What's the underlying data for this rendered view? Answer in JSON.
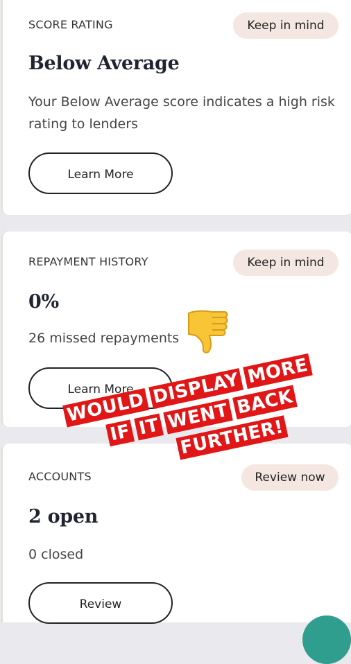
{
  "cards": [
    {
      "label": "SCORE RATING",
      "pill": "Keep in mind",
      "title": "Below Average",
      "description": "Your Below Average score indicates a high risk rating to lenders",
      "button": "Learn More"
    },
    {
      "label": "REPAYMENT HISTORY",
      "pill": "Keep in mind",
      "title": "0%",
      "description": "26 missed repayments",
      "button": "Learn More"
    },
    {
      "label": "ACCOUNTS",
      "pill": "Review now",
      "title": "2 open",
      "description": "0 closed",
      "button": "Review"
    }
  ],
  "overlay": {
    "line1": [
      "WOULD",
      "DISPLAY",
      "MORE"
    ],
    "line2": [
      "IF",
      "IT",
      "WENT",
      "BACK"
    ],
    "line3": [
      "FURTHER!"
    ],
    "color": "#e11616"
  },
  "icons": {
    "emoji": "thumbs-down-icon"
  }
}
